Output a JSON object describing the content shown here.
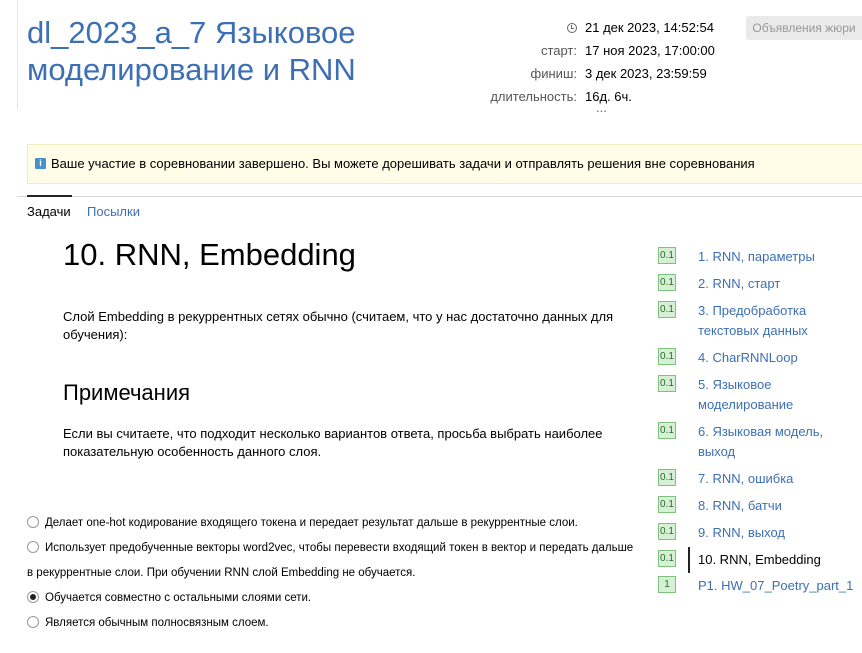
{
  "header": {
    "title": "dl_2023_a_7 Языковое моделирование и RNN",
    "current_time": "21 дек 2023, 14:52:54",
    "start_label": "старт:",
    "start_value": "17 ноя 2023, 17:00:00",
    "finish_label": "финиш:",
    "finish_value": "3 дек 2023, 23:59:59",
    "duration_label": "длительность:",
    "duration_value": "16д. 6ч.",
    "more": "...",
    "jury_button": "Объявления жюри"
  },
  "notice": {
    "icon": "info-icon",
    "text": "Ваше участие в соревновании завершено. Вы можете дорешивать задачи и отправлять решения вне соревнования"
  },
  "tabs": [
    {
      "label": "Задачи",
      "active": true
    },
    {
      "label": "Посылки",
      "active": false
    }
  ],
  "problem": {
    "title": "10. RNN, Embedding",
    "statement": "Слой Embedding в рекуррентных сетях обычно (считаем, что у нас достаточно данных для обучения):",
    "notes_heading": "Примечания",
    "notes_text": "Если вы считаете, что подходит несколько вариантов ответа, просьба выбрать наиболее показательную особенность данного слоя.",
    "options": [
      {
        "text": "Делает one-hot кодирование входящего токена и передает результат дальше в рекуррентные слои.",
        "checked": false
      },
      {
        "text": "Использует предобученные векторы word2vec, чтобы перевести входящий токен в вектор и передать дальше",
        "continuation": "в рекуррентные слои. При обучении RNN слой Embedding не обучается.",
        "checked": false
      },
      {
        "text": "Обучается совместно с остальными слоями сети.",
        "checked": true
      },
      {
        "text": "Является обычным полносвязным слоем.",
        "checked": false
      }
    ]
  },
  "problems_nav": [
    {
      "score": "0.1",
      "label": "1. RNN, параметры"
    },
    {
      "score": "0.1",
      "label": "2. RNN, старт"
    },
    {
      "score": "0.1",
      "label": "3. Предобработка текстовых данных"
    },
    {
      "score": "0.1",
      "label": "4. CharRNNLoop"
    },
    {
      "score": "0.1",
      "label": "5. Языковое моделирование"
    },
    {
      "score": "0.1",
      "label": "6. Языковая модель, выход"
    },
    {
      "score": "0.1",
      "label": "7. RNN, ошибка"
    },
    {
      "score": "0.1",
      "label": "8. RNN, батчи"
    },
    {
      "score": "0.1",
      "label": "9. RNN, выход"
    },
    {
      "score": "0.1",
      "label": "10. RNN, Embedding",
      "current": true
    },
    {
      "score": "1",
      "label": "P1. HW_07_Poetry_part_1"
    }
  ]
}
